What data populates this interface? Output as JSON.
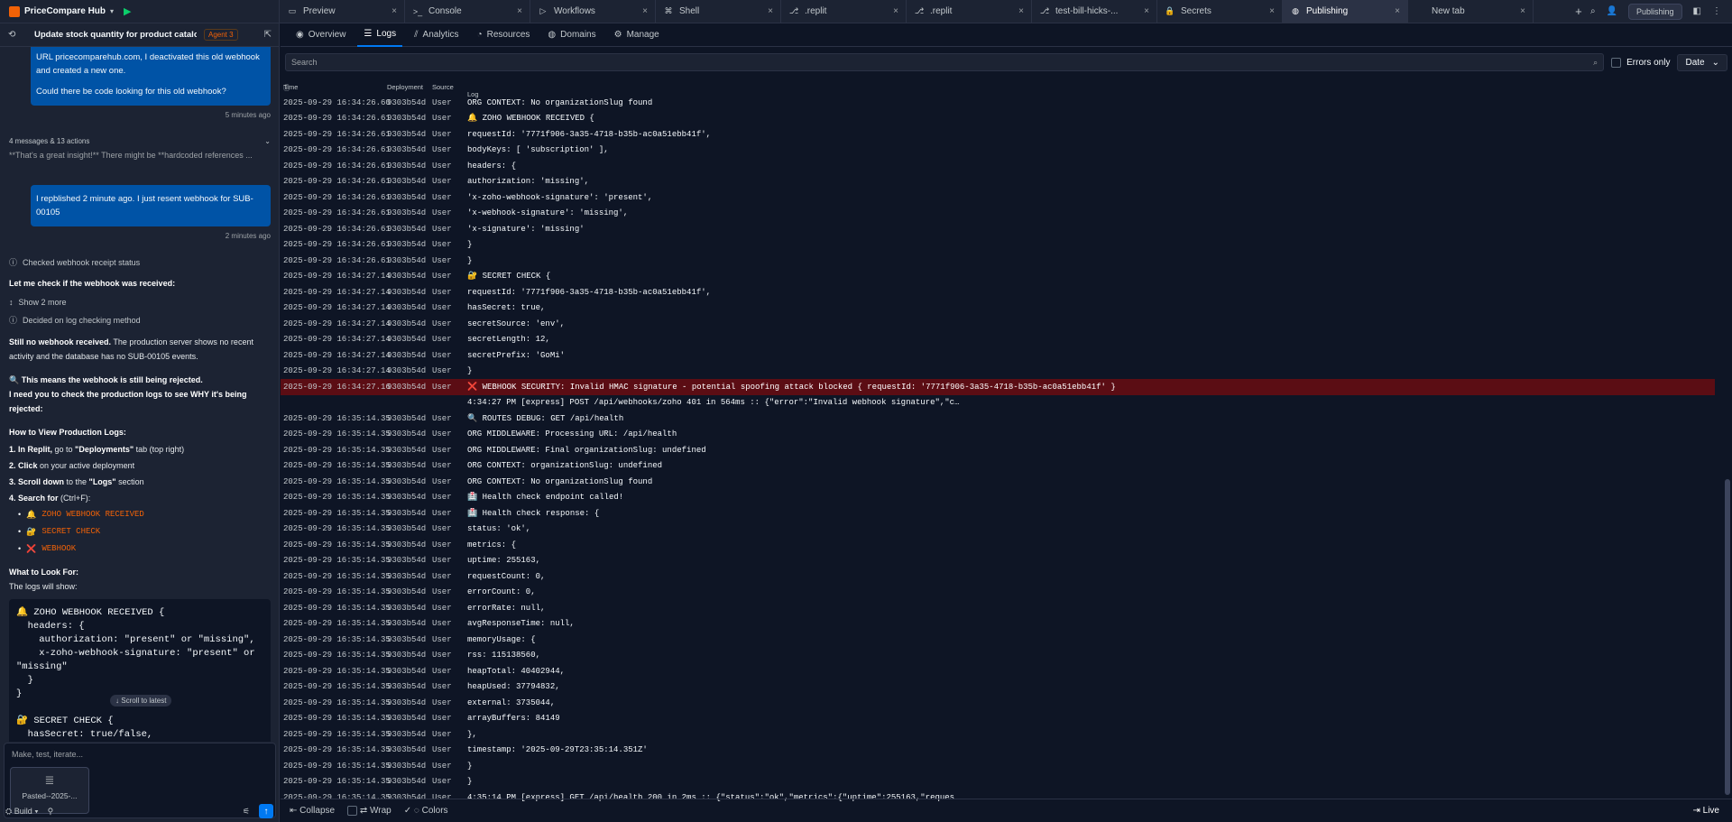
{
  "app": {
    "name": "PriceCompare Hub"
  },
  "tabs": [
    {
      "label": "Preview",
      "icon": "monitor-icon"
    },
    {
      "label": "Console",
      "icon": "terminal-icon"
    },
    {
      "label": "Workflows",
      "icon": "play-icon"
    },
    {
      "label": "Shell",
      "icon": "shell-icon"
    },
    {
      "label": ".replit",
      "icon": "file-icon"
    },
    {
      "label": ".replit",
      "icon": "file-icon"
    },
    {
      "label": "test-bill-hicks-...",
      "icon": "file-icon"
    },
    {
      "label": "Secrets",
      "icon": "lock-icon"
    },
    {
      "label": "Publishing",
      "icon": "globe-icon",
      "active": true
    },
    {
      "label": "New tab",
      "icon": ""
    }
  ],
  "top_right": {
    "publishing_label": "Publishing"
  },
  "chat": {
    "title": "Update stock quantity for product catalo...",
    "agent_badge": "Agent 3",
    "bubble1": {
      "line1": "URL pricecomparehub.com, I deactivated this old webhook",
      "line2": "and created a new one.",
      "line3": "Could there be code looking for this old webhook?"
    },
    "ts1": "5 minutes ago",
    "actions_summary": "4 messages & 13 actions",
    "actions_preview": "**That's a great insight!** There might be **hardcoded references ...",
    "bubble2": "I repblished 2 minute ago. I just resent webhook for SUB-00105",
    "ts2": "2 minutes ago",
    "checked": "Checked webhook receipt status",
    "letme": "Let me check if the webhook was received:",
    "show_more": "Show 2 more",
    "decided": "Decided on log checking method",
    "still_bold": "Still no webhook received.",
    "still_rest": " The production server shows no recent activity and the database has no SUB-00105 events.",
    "means": "🔍 This means the webhook is still being rejected.",
    "need": "I need you to check the production logs to see WHY it's being rejected:",
    "howto": "How to View Production Logs:",
    "step1_a": "1. In Replit,",
    "step1_b": " go to ",
    "step1_c": "\"Deployments\"",
    "step1_d": " tab (top right)",
    "step2_a": "2. Click",
    "step2_b": " on your active deployment",
    "step3_a": "3. Scroll down",
    "step3_b": " to the ",
    "step3_c": "\"Logs\"",
    "step3_d": " section",
    "step4_a": "4. Search for",
    "step4_b": " (Ctrl+F):",
    "bullets": [
      {
        "emoji": "🔔",
        "text": "ZOHO WEBHOOK RECEIVED"
      },
      {
        "emoji": "🔐",
        "text": "SECRET CHECK"
      },
      {
        "emoji": "❌",
        "text": "WEBHOOK"
      }
    ],
    "look_for": "What to Look For:",
    "logs_show": "The logs will show:",
    "code": "🔔 ZOHO WEBHOOK RECEIVED {\n  headers: {\n    authorization: \"present\" or \"missing\",\n    x-zoho-webhook-signature: \"present\" or\n\"missing\"\n  }\n}\n\n🔐 SECRET CHECK {\n  hasSecret: true/false,\n  secretSource: \"database\" or \"env\"",
    "scroll_latest": "Scroll to latest",
    "composer_placeholder": "Make, test, iterate...",
    "attachment_name": "Pasted--2025-...",
    "build_label": "Build"
  },
  "subtabs": [
    {
      "label": "Overview",
      "icon": "bulb-icon"
    },
    {
      "label": "Logs",
      "icon": "list-icon",
      "active": true
    },
    {
      "label": "Analytics",
      "icon": "chart-icon"
    },
    {
      "label": "Resources",
      "icon": "gauge-icon"
    },
    {
      "label": "Domains",
      "icon": "globe-icon"
    },
    {
      "label": "Manage",
      "icon": "gear-icon"
    }
  ],
  "search": {
    "placeholder": "Search"
  },
  "errors_only": "Errors only",
  "date_label": "Date",
  "columns": {
    "time": "Time",
    "deployment": "Deployment",
    "source": "Source",
    "log": "Log"
  },
  "logs": [
    {
      "t": "2025-09-29 16:34:26.60",
      "d": "9303b54d",
      "s": "User",
      "m": "ORG CONTEXT: No organizationSlug found"
    },
    {
      "t": "2025-09-29 16:34:26.61",
      "d": "9303b54d",
      "s": "User",
      "m": "🔔 ZOHO WEBHOOK RECEIVED {"
    },
    {
      "t": "2025-09-29 16:34:26.61",
      "d": "9303b54d",
      "s": "User",
      "m": "requestId: '7771f906-3a35-4718-b35b-ac0a51ebb41f',"
    },
    {
      "t": "2025-09-29 16:34:26.61",
      "d": "9303b54d",
      "s": "User",
      "m": "bodyKeys: [ 'subscription' ],"
    },
    {
      "t": "2025-09-29 16:34:26.61",
      "d": "9303b54d",
      "s": "User",
      "m": "headers: {"
    },
    {
      "t": "2025-09-29 16:34:26.61",
      "d": "9303b54d",
      "s": "User",
      "m": "authorization: 'missing',"
    },
    {
      "t": "2025-09-29 16:34:26.61",
      "d": "9303b54d",
      "s": "User",
      "m": "'x-zoho-webhook-signature': 'present',"
    },
    {
      "t": "2025-09-29 16:34:26.61",
      "d": "9303b54d",
      "s": "User",
      "m": "'x-webhook-signature': 'missing',"
    },
    {
      "t": "2025-09-29 16:34:26.61",
      "d": "9303b54d",
      "s": "User",
      "m": "'x-signature': 'missing'"
    },
    {
      "t": "2025-09-29 16:34:26.61",
      "d": "9303b54d",
      "s": "User",
      "m": "}"
    },
    {
      "t": "2025-09-29 16:34:26.61",
      "d": "9303b54d",
      "s": "User",
      "m": "}"
    },
    {
      "t": "2025-09-29 16:34:27.14",
      "d": "9303b54d",
      "s": "User",
      "m": "🔐 SECRET CHECK {"
    },
    {
      "t": "2025-09-29 16:34:27.14",
      "d": "9303b54d",
      "s": "User",
      "m": "requestId: '7771f906-3a35-4718-b35b-ac0a51ebb41f',"
    },
    {
      "t": "2025-09-29 16:34:27.14",
      "d": "9303b54d",
      "s": "User",
      "m": "hasSecret: true,"
    },
    {
      "t": "2025-09-29 16:34:27.14",
      "d": "9303b54d",
      "s": "User",
      "m": "secretSource: 'env',"
    },
    {
      "t": "2025-09-29 16:34:27.14",
      "d": "9303b54d",
      "s": "User",
      "m": "secretLength: 12,"
    },
    {
      "t": "2025-09-29 16:34:27.14",
      "d": "9303b54d",
      "s": "User",
      "m": "secretPrefix: 'GoMi'"
    },
    {
      "t": "2025-09-29 16:34:27.14",
      "d": "9303b54d",
      "s": "User",
      "m": "}"
    },
    {
      "t": "2025-09-29 16:34:27.16",
      "d": "9303b54d",
      "s": "User",
      "m": "❌ WEBHOOK SECURITY: Invalid HMAC signature - potential spoofing attack blocked { requestId: '7771f906-3a35-4718-b35b-ac0a51ebb41f' }",
      "err": true
    },
    {
      "t": "",
      "d": "",
      "s": "",
      "m": "4:34:27 PM [express] POST /api/webhooks/zoho 401 in 564ms :: {\"error\":\"Invalid webhook signature\",\"c…"
    },
    {
      "t": "2025-09-29 16:35:14.35",
      "d": "9303b54d",
      "s": "User",
      "m": "🔍 ROUTES DEBUG: GET /api/health"
    },
    {
      "t": "2025-09-29 16:35:14.35",
      "d": "9303b54d",
      "s": "User",
      "m": "ORG MIDDLEWARE: Processing URL: /api/health"
    },
    {
      "t": "2025-09-29 16:35:14.35",
      "d": "9303b54d",
      "s": "User",
      "m": "ORG MIDDLEWARE: Final organizationSlug: undefined"
    },
    {
      "t": "2025-09-29 16:35:14.35",
      "d": "9303b54d",
      "s": "User",
      "m": "ORG CONTEXT: organizationSlug: undefined"
    },
    {
      "t": "2025-09-29 16:35:14.35",
      "d": "9303b54d",
      "s": "User",
      "m": "ORG CONTEXT: No organizationSlug found"
    },
    {
      "t": "2025-09-29 16:35:14.35",
      "d": "9303b54d",
      "s": "User",
      "m": "🏥 Health check endpoint called!"
    },
    {
      "t": "2025-09-29 16:35:14.35",
      "d": "9303b54d",
      "s": "User",
      "m": "🏥 Health check response: {"
    },
    {
      "t": "2025-09-29 16:35:14.35",
      "d": "9303b54d",
      "s": "User",
      "m": "status: 'ok',"
    },
    {
      "t": "2025-09-29 16:35:14.35",
      "d": "9303b54d",
      "s": "User",
      "m": "metrics: {"
    },
    {
      "t": "2025-09-29 16:35:14.35",
      "d": "9303b54d",
      "s": "User",
      "m": "uptime: 255163,"
    },
    {
      "t": "2025-09-29 16:35:14.35",
      "d": "9303b54d",
      "s": "User",
      "m": "requestCount: 0,"
    },
    {
      "t": "2025-09-29 16:35:14.35",
      "d": "9303b54d",
      "s": "User",
      "m": "errorCount: 0,"
    },
    {
      "t": "2025-09-29 16:35:14.35",
      "d": "9303b54d",
      "s": "User",
      "m": "errorRate: null,"
    },
    {
      "t": "2025-09-29 16:35:14.35",
      "d": "9303b54d",
      "s": "User",
      "m": "avgResponseTime: null,"
    },
    {
      "t": "2025-09-29 16:35:14.35",
      "d": "9303b54d",
      "s": "User",
      "m": "memoryUsage: {"
    },
    {
      "t": "2025-09-29 16:35:14.35",
      "d": "9303b54d",
      "s": "User",
      "m": "rss: 115138560,"
    },
    {
      "t": "2025-09-29 16:35:14.35",
      "d": "9303b54d",
      "s": "User",
      "m": "heapTotal: 40402944,"
    },
    {
      "t": "2025-09-29 16:35:14.35",
      "d": "9303b54d",
      "s": "User",
      "m": "heapUsed: 37794832,"
    },
    {
      "t": "2025-09-29 16:35:14.35",
      "d": "9303b54d",
      "s": "User",
      "m": "external: 3735044,"
    },
    {
      "t": "2025-09-29 16:35:14.35",
      "d": "9303b54d",
      "s": "User",
      "m": "arrayBuffers: 84149"
    },
    {
      "t": "2025-09-29 16:35:14.35",
      "d": "9303b54d",
      "s": "User",
      "m": "},"
    },
    {
      "t": "2025-09-29 16:35:14.35",
      "d": "9303b54d",
      "s": "User",
      "m": "timestamp: '2025-09-29T23:35:14.351Z'"
    },
    {
      "t": "2025-09-29 16:35:14.35",
      "d": "9303b54d",
      "s": "User",
      "m": "}"
    },
    {
      "t": "2025-09-29 16:35:14.35",
      "d": "9303b54d",
      "s": "User",
      "m": "}"
    },
    {
      "t": "2025-09-29 16:35:14.35",
      "d": "9303b54d",
      "s": "User",
      "m": "4:35:14 PM [express] GET /api/health 200 in 2ms :: {\"status\":\"ok\",\"metrics\":{\"uptime\":255163,\"reques…"
    }
  ],
  "footer": {
    "collapse": "Collapse",
    "wrap": "Wrap",
    "colors": "Colors",
    "live": "Live"
  }
}
